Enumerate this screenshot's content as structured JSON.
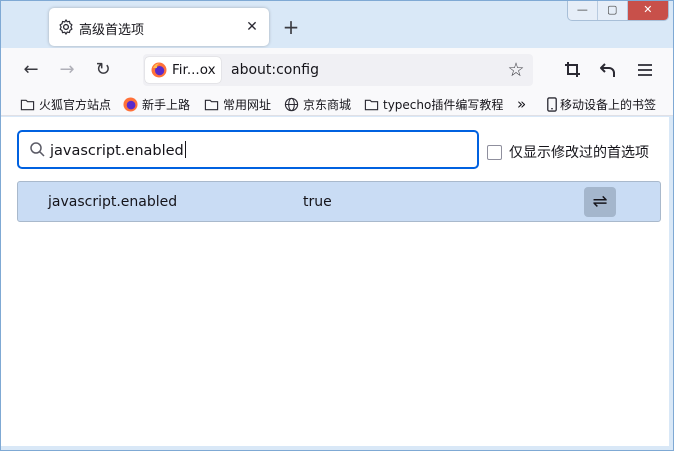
{
  "tab": {
    "title": "高级首选项",
    "close": "✕",
    "new_tab": "+"
  },
  "window_controls": {
    "minimize": "—",
    "maximize": "▢",
    "close": "✕"
  },
  "nav": {
    "back": "←",
    "forward": "→",
    "reload": "↻",
    "identity_label": "Fir...ox",
    "url": "about:config",
    "bookmark_star": "☆",
    "toolbar_icons": [
      "crop-icon",
      "undo-icon",
      "menu-icon"
    ]
  },
  "bookmarks": {
    "items": [
      {
        "icon": "folder-icon",
        "label": "火狐官方站点"
      },
      {
        "icon": "firefox-icon",
        "label": "新手上路"
      },
      {
        "icon": "folder-icon",
        "label": "常用网址"
      },
      {
        "icon": "globe-icon",
        "label": "京东商城"
      },
      {
        "icon": "folder-icon",
        "label": "typecho插件编写教程"
      }
    ],
    "overflow": "»",
    "mobile": {
      "icon": "phone-icon",
      "label": "移动设备上的书签"
    }
  },
  "config": {
    "search_value": "javascript.enabled",
    "show_modified_label": "仅显示修改过的首选项",
    "show_modified_checked": false,
    "prefs": [
      {
        "name": "javascript.enabled",
        "value": "true",
        "toggle_glyph": "⇌"
      }
    ]
  },
  "colors": {
    "accent": "#0061e0",
    "row_highlight": "#c9dcf4",
    "frame": "#d9e8f7"
  }
}
